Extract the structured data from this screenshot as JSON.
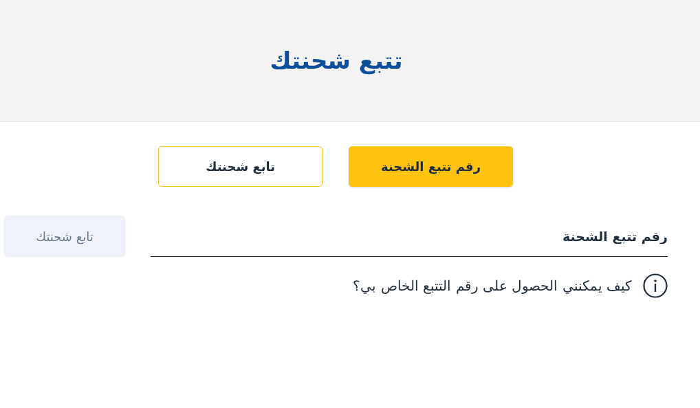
{
  "header": {
    "title": "تتبع شحنتك"
  },
  "tabs": [
    {
      "label": "رقم تتبع الشحنة",
      "selected": true
    },
    {
      "label": "تابع شحنتك",
      "selected": false
    }
  ],
  "tracking_field": {
    "placeholder": "رقم تتبع الشحنة"
  },
  "submit_button": {
    "label": "تابع شحنتك",
    "disabled": true
  },
  "help_link": {
    "text": "كيف يمكنني الحصول على رقم التتبع الخاص بي؟"
  }
}
